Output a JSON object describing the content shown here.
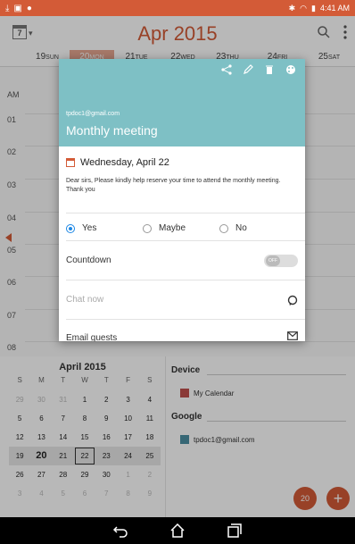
{
  "status_bar": {
    "time": "4:41 AM"
  },
  "header": {
    "view_icon_day": "7",
    "month_title": "Apr 2015"
  },
  "days": [
    {
      "num": "19",
      "name": "SUN"
    },
    {
      "num": "20",
      "name": "MON"
    },
    {
      "num": "21",
      "name": "TUE"
    },
    {
      "num": "22",
      "name": "WED"
    },
    {
      "num": "23",
      "name": "THU"
    },
    {
      "num": "24",
      "name": "FRI"
    },
    {
      "num": "25",
      "name": "SAT"
    }
  ],
  "hours": [
    "AM",
    "01",
    "02",
    "03",
    "04",
    "05",
    "06",
    "07",
    "08"
  ],
  "event_dialog": {
    "email": "tpdoc1@gmail.com",
    "title": "Monthly meeting",
    "date": "Wednesday, April 22",
    "description": "Dear sirs, Please kindly help reserve your time to attend the monthly meeting. Thank you",
    "rsvp": {
      "yes": "Yes",
      "maybe": "Maybe",
      "no": "No",
      "selected": "Yes"
    },
    "countdown_label": "Countdown",
    "countdown_toggle": "OFF",
    "chat_label": "Chat now",
    "email_guests_label": "Email guests"
  },
  "mini_calendar": {
    "title": "April 2015",
    "weekday_headers": [
      "S",
      "M",
      "T",
      "W",
      "T",
      "F",
      "S"
    ],
    "weeks": [
      [
        "29",
        "30",
        "31",
        "1",
        "2",
        "3",
        "4"
      ],
      [
        "5",
        "6",
        "7",
        "8",
        "9",
        "10",
        "11"
      ],
      [
        "12",
        "13",
        "14",
        "15",
        "16",
        "17",
        "18"
      ],
      [
        "19",
        "20",
        "21",
        "22",
        "23",
        "24",
        "25"
      ],
      [
        "26",
        "27",
        "28",
        "29",
        "30",
        "1",
        "2"
      ],
      [
        "3",
        "4",
        "5",
        "6",
        "7",
        "8",
        "9"
      ]
    ]
  },
  "calendars": {
    "device_title": "Device",
    "device_cal": "My Calendar",
    "google_title": "Google",
    "google_cal": "tpdoc1@gmail.com"
  },
  "fab": {
    "today_day": "20",
    "add_symbol": "+"
  },
  "colors": {
    "accent": "#d35b37",
    "event": "#7ec0c5",
    "device_swatch": "#c0504d",
    "google_swatch": "#4d8fa3"
  }
}
